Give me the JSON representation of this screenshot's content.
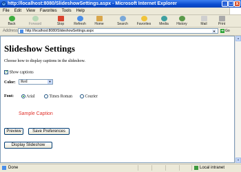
{
  "window": {
    "title": "http://localhost:8080/SlideshowSettings.aspx - Microsoft Internet Explorer",
    "controls": [
      "_",
      "□",
      "x"
    ]
  },
  "menu": [
    "File",
    "Edit",
    "View",
    "Favorites",
    "Tools",
    "Help"
  ],
  "toolbar": {
    "back": "Back",
    "forward": "Forward",
    "stop": "Stop",
    "refresh": "Refresh",
    "home": "Home",
    "search": "Search",
    "favorites": "Favorites",
    "media": "Media",
    "history": "History",
    "mail": "Mail",
    "print": "Print"
  },
  "address": {
    "label": "Address",
    "url": "http://localhost:8080/SlideshowSettings.aspx",
    "go": "Go"
  },
  "page": {
    "title": "Slideshow Settings",
    "intro": "Choose how to display captions in the slideshow.",
    "show_captions_label": "Show captions",
    "color_label": "Color:",
    "color_value": "Red",
    "font_label": "Font:",
    "font_options": [
      "Arial",
      "Times Roman",
      "Courier"
    ],
    "font_selected": "Arial",
    "sample_caption": "Sample Caption",
    "sample_color": "#e0302a",
    "preview_button": "Preview",
    "save_button": "Save Preferences",
    "display_button": "Display Slideshow"
  },
  "status": {
    "text": "Done",
    "zone": "Local intranet"
  }
}
